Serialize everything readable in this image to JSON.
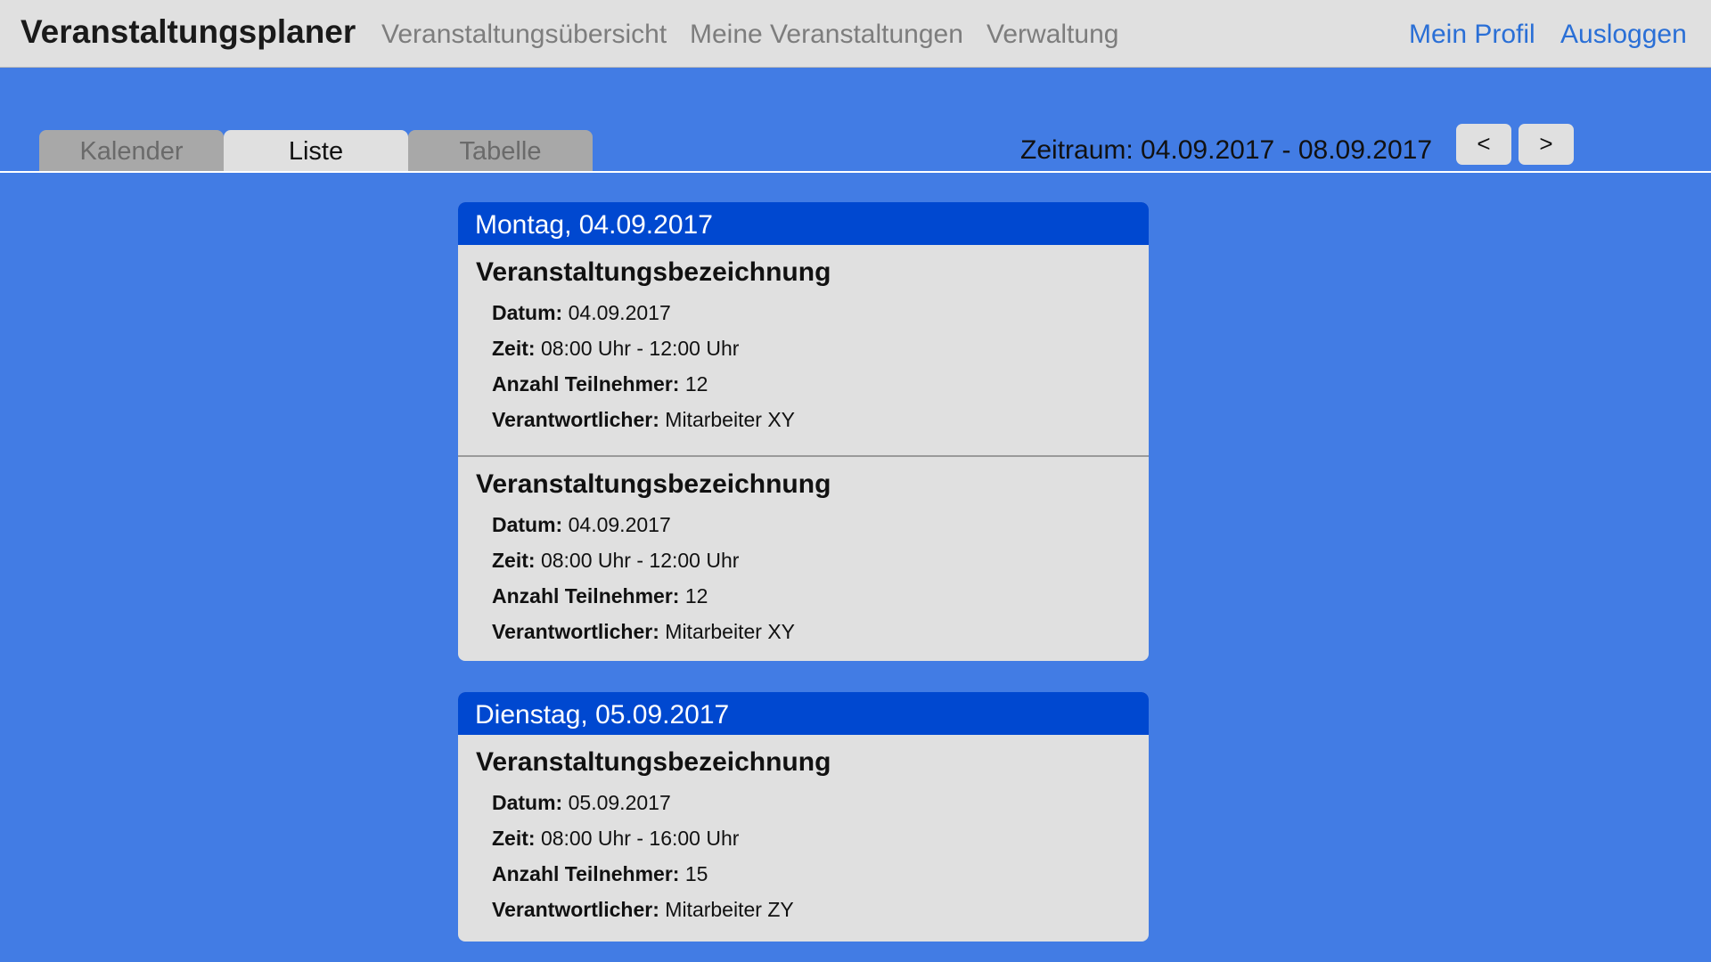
{
  "header": {
    "brand": "Veranstaltungsplaner",
    "nav": [
      "Veranstaltungsübersicht",
      "Meine Veranstaltungen",
      "Verwaltung"
    ],
    "profile": "Mein Profil",
    "logout": "Ausloggen"
  },
  "tabs": [
    "Kalender",
    "Liste",
    "Tabelle"
  ],
  "active_tab": "Liste",
  "period": {
    "label": "Zeitraum: 04.09.2017 - 08.09.2017",
    "prev": "<",
    "next": ">"
  },
  "labels": {
    "date": "Datum:",
    "time": "Zeit:",
    "participants": "Anzahl Teilnehmer:",
    "responsible": "Verantwortlicher:"
  },
  "days": [
    {
      "header": "Montag, 04.09.2017",
      "events": [
        {
          "title": "Veranstaltungsbezeichnung",
          "date": "04.09.2017",
          "time": "08:00 Uhr - 12:00 Uhr",
          "participants": "12",
          "responsible": "Mitarbeiter XY"
        },
        {
          "title": "Veranstaltungsbezeichnung",
          "date": "04.09.2017",
          "time": "08:00 Uhr - 12:00 Uhr",
          "participants": "12",
          "responsible": "Mitarbeiter XY"
        }
      ]
    },
    {
      "header": "Dienstag, 05.09.2017",
      "events": [
        {
          "title": "Veranstaltungsbezeichnung",
          "date": "05.09.2017",
          "time": "08:00 Uhr - 16:00 Uhr",
          "participants": "15",
          "responsible": "Mitarbeiter ZY"
        }
      ]
    }
  ],
  "colors": {
    "page_bg": "#427ce4",
    "day_header_bg": "#0048d0",
    "card_bg": "#e0e0e0",
    "link": "#2a6fd6"
  }
}
